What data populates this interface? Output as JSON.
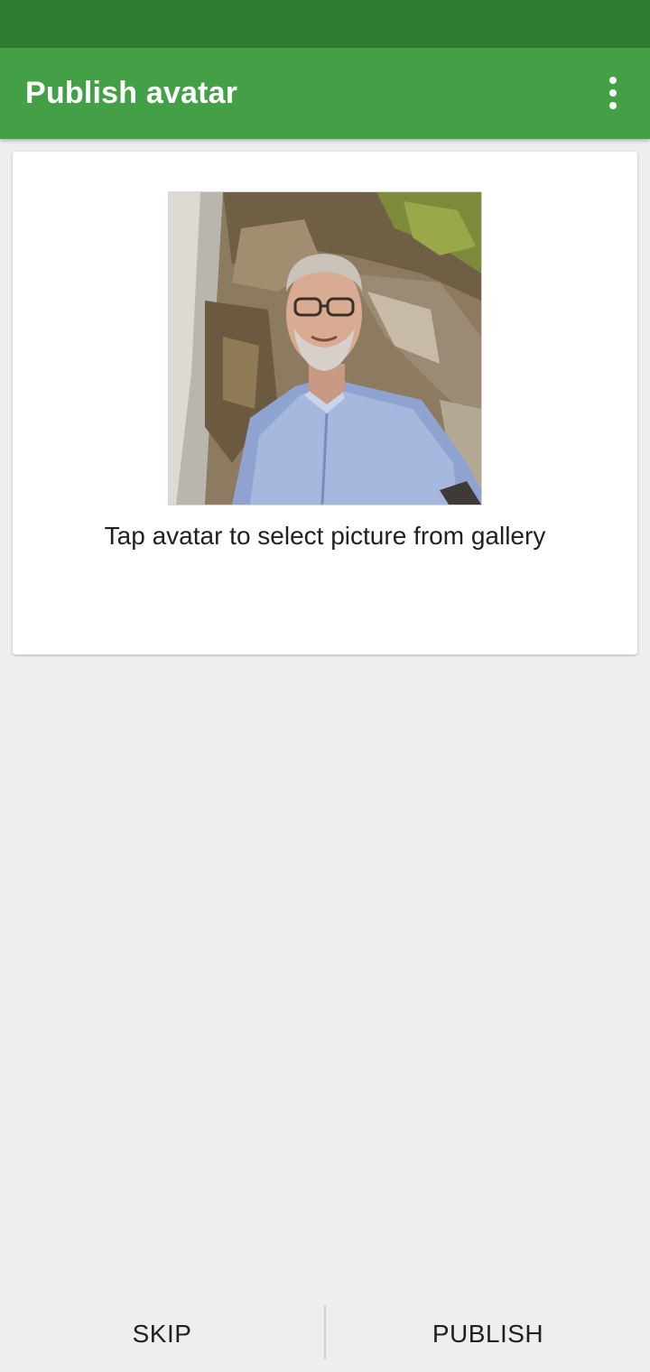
{
  "app_bar": {
    "title": "Publish avatar",
    "menu_icon": "more-vert-icon"
  },
  "colors": {
    "status_bar": "#2e7d32",
    "app_bar": "#43a047",
    "background": "#eeeeee",
    "card": "#ffffff"
  },
  "card": {
    "avatar_icon": "avatar-photo",
    "hint": "Tap avatar to select picture from gallery"
  },
  "bottom_bar": {
    "skip_label": "SKIP",
    "publish_label": "PUBLISH"
  }
}
